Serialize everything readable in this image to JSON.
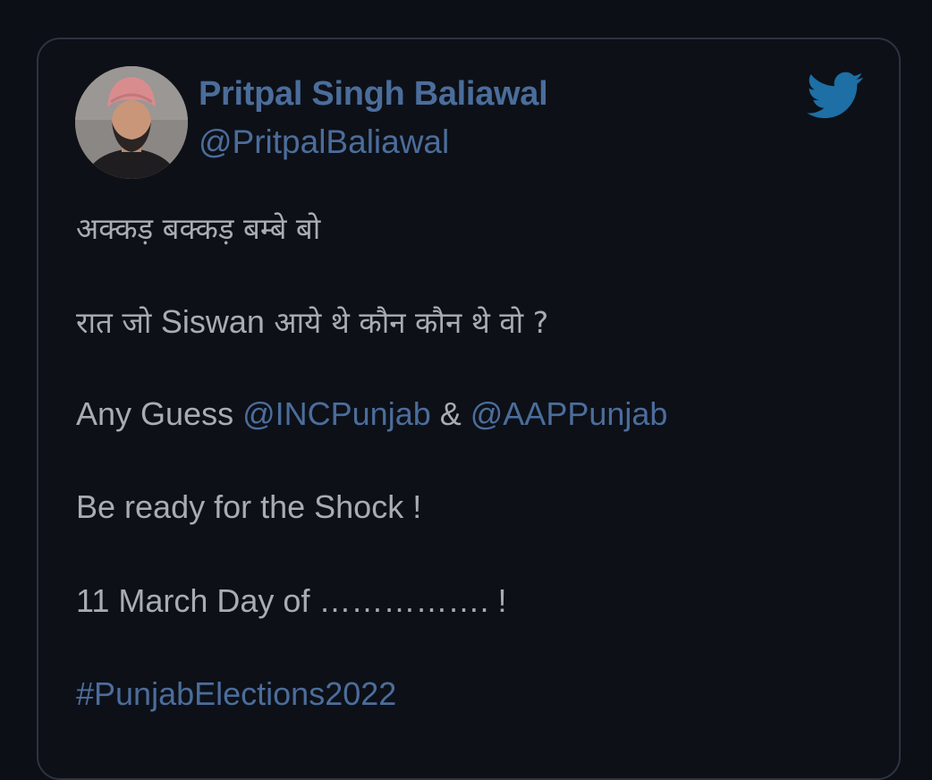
{
  "tweet": {
    "author": {
      "display_name": "Pritpal Singh Baliawal",
      "handle": "@PritpalBaliawal",
      "avatar_alt": "profile photo"
    },
    "brand_icon": "twitter-bird-icon",
    "colors": {
      "background": "#0c0f15",
      "card_border": "#2e3340",
      "link": "#4b6d9b",
      "text": "#a9acb2",
      "bird": "#1d6fa5"
    },
    "body": {
      "line1": "अक्कड़ बक्कड़ बम्बे बो",
      "line2_part1": "रात जो ",
      "line2_part2": "Siswan",
      "line2_part3": " आये थे कौन कौन थे वो ?",
      "line3_prefix": "Any Guess ",
      "mention1": "@INCPunjab",
      "line3_mid": " & ",
      "mention2": "@AAPPunjab",
      "line4": "Be ready for the Shock !",
      "line5": "11 March Day of ……………. !",
      "hashtag": "#PunjabElections2022"
    }
  }
}
